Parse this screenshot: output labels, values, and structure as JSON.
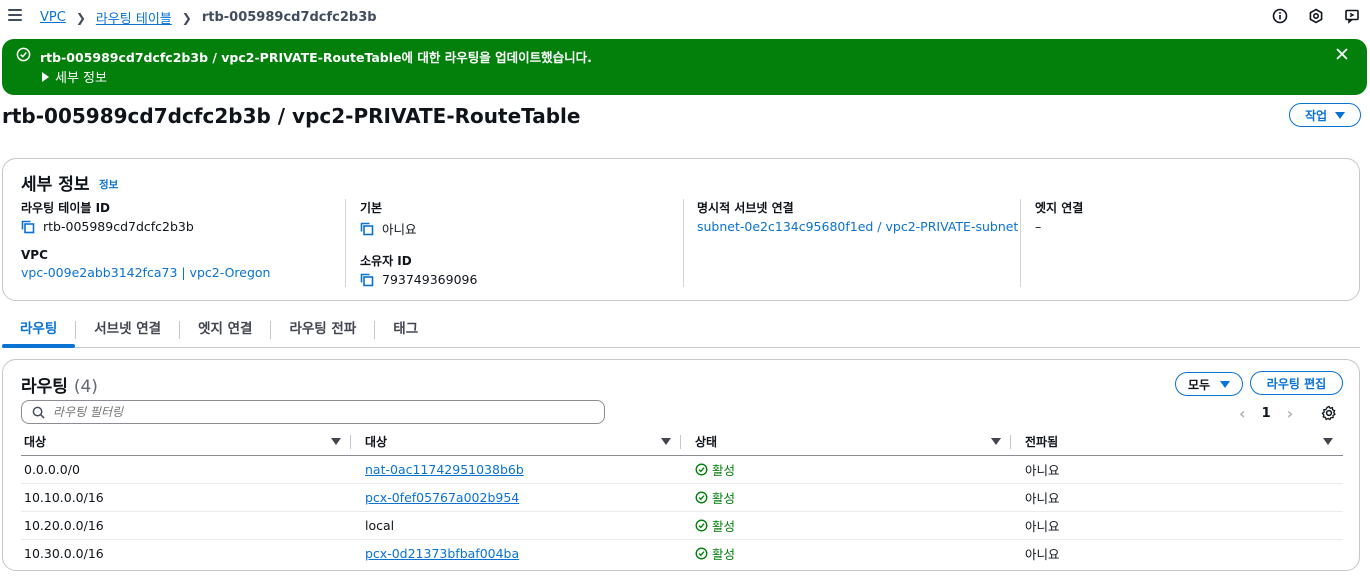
{
  "breadcrumb": {
    "items": [
      "VPC",
      "라우팅 테이블"
    ],
    "current": "rtb-005989cd7dcfc2b3b"
  },
  "flash": {
    "message": "rtb-005989cd7dcfc2b3b / vpc2-PRIVATE-RouteTable에 대한 라우팅을 업데이트했습니다.",
    "details_label": "세부 정보"
  },
  "page": {
    "title": "rtb-005989cd7dcfc2b3b / vpc2-PRIVATE-RouteTable",
    "actions_label": "작업"
  },
  "details": {
    "title": "세부 정보",
    "info_label": "정보",
    "route_table_id_label": "라우팅 테이블 ID",
    "route_table_id": "rtb-005989cd7dcfc2b3b",
    "main_label": "기본",
    "main_value": "아니요",
    "explicit_subnet_label": "명시적 서브넷 연결",
    "explicit_subnet_value": "subnet-0e2c134c95680f1ed / vpc2-PRIVATE-subnet",
    "edge_label": "엣지 연결",
    "edge_value": "–",
    "vpc_label": "VPC",
    "vpc_value": "vpc-009e2abb3142fca73 | vpc2-Oregon",
    "owner_label": "소유자 ID",
    "owner_value": "793749369096"
  },
  "tabs": [
    "라우팅",
    "서브넷 연결",
    "엣지 연결",
    "라우팅 전파",
    "태그"
  ],
  "routes": {
    "title": "라우팅",
    "count": "(4)",
    "filter_label": "모두",
    "edit_label": "라우팅 편집",
    "search_placeholder": "라우팅 필터링",
    "page": "1",
    "columns": [
      "대상",
      "대상",
      "상태",
      "전파됨"
    ],
    "rows": [
      {
        "destination": "0.0.0.0/0",
        "target": "nat-0ac11742951038b6b",
        "target_link": true,
        "status": "활성",
        "propagated": "아니요"
      },
      {
        "destination": "10.10.0.0/16",
        "target": "pcx-0fef05767a002b954",
        "target_link": true,
        "status": "활성",
        "propagated": "아니요"
      },
      {
        "destination": "10.20.0.0/16",
        "target": "local",
        "target_link": false,
        "status": "활성",
        "propagated": "아니요"
      },
      {
        "destination": "10.30.0.0/16",
        "target": "pcx-0d21373bfbaf004ba",
        "target_link": true,
        "status": "활성",
        "propagated": "아니요"
      }
    ]
  },
  "colors": {
    "accent": "#0972d3",
    "success": "#037f0c"
  }
}
